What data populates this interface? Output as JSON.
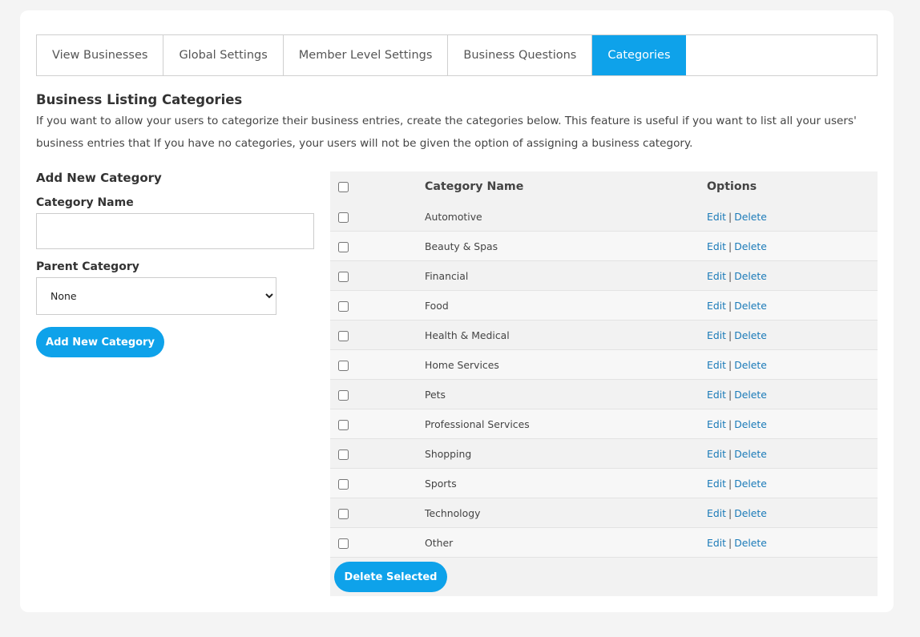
{
  "tabs": [
    {
      "label": "View Businesses",
      "active": false
    },
    {
      "label": "Global Settings",
      "active": false
    },
    {
      "label": "Member Level Settings",
      "active": false
    },
    {
      "label": "Business Questions",
      "active": false
    },
    {
      "label": "Categories",
      "active": true
    }
  ],
  "section": {
    "title": "Business Listing Categories",
    "description": "If you want to allow your users to categorize their business entries, create the categories below. This feature is useful if you want to list all your users' business entries that If you have no categories, your users will not be given the option of assigning a business category."
  },
  "form": {
    "heading": "Add New Category",
    "name_label": "Category Name",
    "name_value": "",
    "parent_label": "Parent Category",
    "parent_selected": "None",
    "submit_label": "Add New Category"
  },
  "table": {
    "headers": {
      "name": "Category Name",
      "options": "Options"
    },
    "edit_label": "Edit",
    "delete_label": "Delete",
    "separator": "|",
    "rows": [
      {
        "name": "Automotive"
      },
      {
        "name": "Beauty & Spas"
      },
      {
        "name": "Financial"
      },
      {
        "name": "Food"
      },
      {
        "name": "Health & Medical"
      },
      {
        "name": "Home Services"
      },
      {
        "name": "Pets"
      },
      {
        "name": "Professional Services"
      },
      {
        "name": "Shopping"
      },
      {
        "name": "Sports"
      },
      {
        "name": "Technology"
      },
      {
        "name": "Other"
      }
    ],
    "delete_selected_label": "Delete Selected"
  },
  "colors": {
    "accent": "#0ea2ea",
    "link": "#1a7ab8"
  }
}
